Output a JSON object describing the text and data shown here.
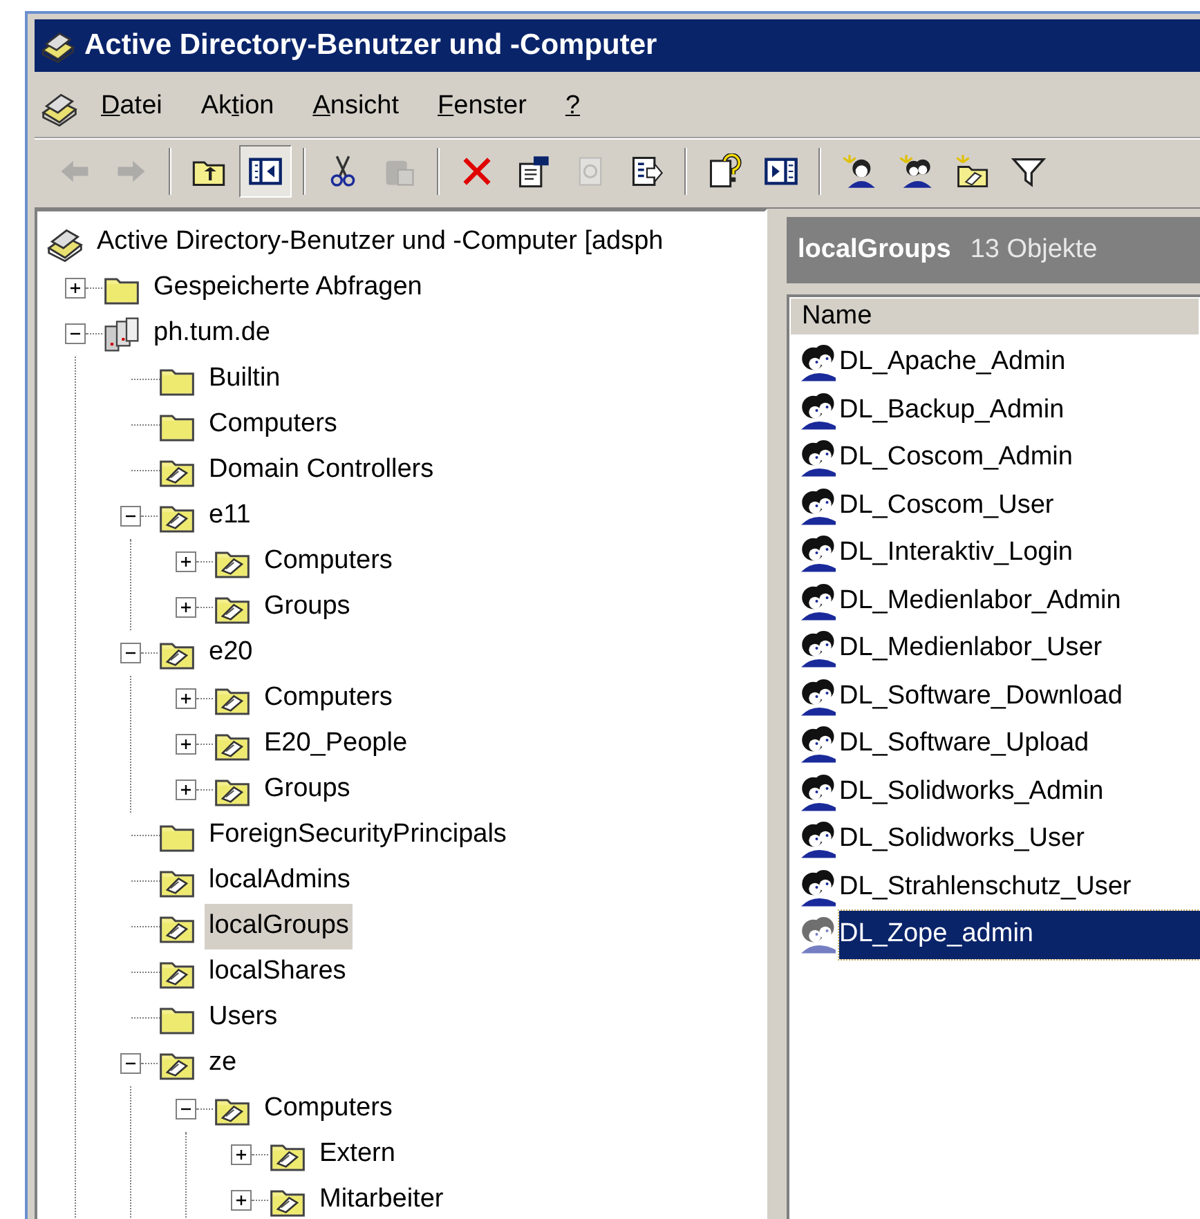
{
  "window": {
    "title": "Active Directory-Benutzer und -Computer"
  },
  "menu": [
    {
      "mnemonic": "D",
      "rest": "atei"
    },
    {
      "before": "Ak",
      "mnemonic": "t",
      "rest": "ion"
    },
    {
      "mnemonic": "A",
      "rest": "nsicht"
    },
    {
      "mnemonic": "F",
      "rest": "enster"
    },
    {
      "mnemonic": "?"
    }
  ],
  "toolbar": [
    {
      "kind": "button",
      "disabled": true,
      "pressed": false
    },
    {
      "kind": "button",
      "disabled": true,
      "pressed": false
    },
    {
      "kind": "separator"
    },
    {
      "kind": "button",
      "disabled": false,
      "pressed": false
    },
    {
      "kind": "button",
      "disabled": false,
      "pressed": true
    },
    {
      "kind": "separator"
    },
    {
      "kind": "button",
      "disabled": false,
      "pressed": false
    },
    {
      "kind": "button",
      "disabled": true,
      "pressed": false
    },
    {
      "kind": "separator"
    },
    {
      "kind": "button",
      "disabled": false,
      "pressed": false
    },
    {
      "kind": "button",
      "disabled": false,
      "pressed": false
    },
    {
      "kind": "button",
      "disabled": true,
      "pressed": false
    },
    {
      "kind": "button",
      "disabled": false,
      "pressed": false
    },
    {
      "kind": "separator"
    },
    {
      "kind": "button",
      "disabled": false,
      "pressed": false
    },
    {
      "kind": "button",
      "disabled": false,
      "pressed": false
    },
    {
      "kind": "separator"
    },
    {
      "kind": "button",
      "disabled": false,
      "pressed": false
    },
    {
      "kind": "button",
      "disabled": false,
      "pressed": false
    },
    {
      "kind": "button",
      "disabled": false,
      "pressed": false
    },
    {
      "kind": "button",
      "disabled": false,
      "pressed": false
    }
  ],
  "tree": [
    {
      "label": "Active Directory-Benutzer und -Computer [adsph",
      "kind": "snapin",
      "selected": false,
      "children": [
        {
          "label": "Gespeicherte Abfragen",
          "kind": "container",
          "expanded": false,
          "selected": false
        },
        {
          "label": "ph.tum.de",
          "kind": "domain",
          "expanded": true,
          "selected": false,
          "children": [
            {
              "label": "Builtin",
              "kind": "container",
              "selected": false
            },
            {
              "label": "Computers",
              "kind": "container",
              "selected": false
            },
            {
              "label": "Domain Controllers",
              "kind": "ou",
              "selected": false
            },
            {
              "label": "e11",
              "kind": "ou",
              "expanded": true,
              "selected": false,
              "children": [
                {
                  "label": "Computers",
                  "kind": "ou",
                  "expanded": false,
                  "selected": false
                },
                {
                  "label": "Groups",
                  "kind": "ou",
                  "expanded": false,
                  "selected": false
                }
              ]
            },
            {
              "label": "e20",
              "kind": "ou",
              "expanded": true,
              "selected": false,
              "children": [
                {
                  "label": "Computers",
                  "kind": "ou",
                  "expanded": false,
                  "selected": false
                },
                {
                  "label": "E20_People",
                  "kind": "ou",
                  "expanded": false,
                  "selected": false
                },
                {
                  "label": "Groups",
                  "kind": "ou",
                  "expanded": false,
                  "selected": false
                }
              ]
            },
            {
              "label": "ForeignSecurityPrincipals",
              "kind": "container",
              "selected": false
            },
            {
              "label": "localAdmins",
              "kind": "ou",
              "selected": false
            },
            {
              "label": "localGroups",
              "kind": "ou",
              "selected": true
            },
            {
              "label": "localShares",
              "kind": "ou",
              "selected": false
            },
            {
              "label": "Users",
              "kind": "container",
              "selected": false
            },
            {
              "label": "ze",
              "kind": "ou",
              "expanded": true,
              "selected": false,
              "children": [
                {
                  "label": "Computers",
                  "kind": "ou",
                  "expanded": true,
                  "selected": false,
                  "children": [
                    {
                      "label": "Extern",
                      "kind": "ou",
                      "expanded": false,
                      "selected": false
                    },
                    {
                      "label": "Mitarbeiter",
                      "kind": "ou",
                      "expanded": false,
                      "selected": false
                    }
                  ]
                }
              ]
            }
          ]
        }
      ]
    }
  ],
  "details": {
    "title": "localGroups",
    "count": "13 Objekte",
    "columns": [
      "Name"
    ],
    "rows": [
      {
        "name": "DL_Apache_Admin",
        "selected": false
      },
      {
        "name": "DL_Backup_Admin",
        "selected": false
      },
      {
        "name": "DL_Coscom_Admin",
        "selected": false
      },
      {
        "name": "DL_Coscom_User",
        "selected": false
      },
      {
        "name": "DL_Interaktiv_Login",
        "selected": false
      },
      {
        "name": "DL_Medienlabor_Admin",
        "selected": false
      },
      {
        "name": "DL_Medienlabor_User",
        "selected": false
      },
      {
        "name": "DL_Software_Download",
        "selected": false
      },
      {
        "name": "DL_Software_Upload",
        "selected": false
      },
      {
        "name": "DL_Solidworks_Admin",
        "selected": false
      },
      {
        "name": "DL_Solidworks_User",
        "selected": false
      },
      {
        "name": "DL_Strahlenschutz_User",
        "selected": false
      },
      {
        "name": "DL_Zope_admin",
        "selected": true
      }
    ]
  }
}
